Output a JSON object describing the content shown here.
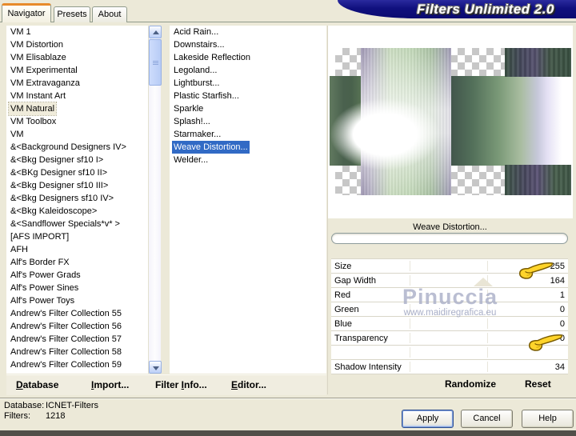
{
  "window": {
    "title": "Filters Unlimited 2.0",
    "tabs": [
      {
        "label": "Navigator",
        "active": true
      },
      {
        "label": "Presets",
        "active": false
      },
      {
        "label": "About",
        "active": false
      }
    ]
  },
  "category_list": {
    "items": [
      {
        "label": "VM 1"
      },
      {
        "label": "VM Distortion"
      },
      {
        "label": "VM Elisablaze"
      },
      {
        "label": "VM Experimental"
      },
      {
        "label": "VM Extravaganza"
      },
      {
        "label": "VM Instant Art"
      },
      {
        "label": "VM Natural",
        "selected": true
      },
      {
        "label": "VM Toolbox"
      },
      {
        "label": "VM"
      },
      {
        "label": "&<Background Designers IV>"
      },
      {
        "label": "&<Bkg Designer sf10 I>"
      },
      {
        "label": "&<BKg Designer sf10 II>"
      },
      {
        "label": "&<Bkg Designer sf10 III>"
      },
      {
        "label": "&<Bkg Designers sf10 IV>"
      },
      {
        "label": "&<Bkg Kaleidoscope>"
      },
      {
        "label": "&<Sandflower Specials*v* >"
      },
      {
        "label": "[AFS IMPORT]"
      },
      {
        "label": "AFH"
      },
      {
        "label": "Alf's Border FX"
      },
      {
        "label": "Alf's Power Grads"
      },
      {
        "label": "Alf's Power Sines"
      },
      {
        "label": "Alf's Power Toys"
      },
      {
        "label": "Andrew's Filter Collection 55"
      },
      {
        "label": "Andrew's Filter Collection 56"
      },
      {
        "label": "Andrew's Filter Collection 57"
      },
      {
        "label": "Andrew's Filter Collection 58"
      },
      {
        "label": "Andrew's Filter Collection 59"
      }
    ]
  },
  "filter_list": {
    "items": [
      {
        "label": "Acid Rain..."
      },
      {
        "label": "Downstairs..."
      },
      {
        "label": "Lakeside Reflection"
      },
      {
        "label": "Legoland..."
      },
      {
        "label": "Lightburst..."
      },
      {
        "label": "Plastic Starfish..."
      },
      {
        "label": "Sparkle"
      },
      {
        "label": "Splash!..."
      },
      {
        "label": "Starmaker..."
      },
      {
        "label": "Weave Distortion...",
        "selected": true
      },
      {
        "label": "Welder..."
      }
    ]
  },
  "preview": {
    "filter_name": "Weave Distortion...",
    "progress_percent": 0
  },
  "parameters": {
    "rows": [
      {
        "label": "Size",
        "value": "255"
      },
      {
        "label": "Gap Width",
        "value": "164"
      },
      {
        "label": "Red",
        "value": "1"
      },
      {
        "label": "Green",
        "value": "0"
      },
      {
        "label": "Blue",
        "value": "0"
      },
      {
        "label": "Transparency",
        "value": "0"
      },
      {
        "label": "",
        "value": ""
      },
      {
        "label": "Shadow Intensity",
        "value": "34"
      }
    ]
  },
  "watermark": {
    "name": "Pinuccia",
    "url": "www.maidiregrafica.eu"
  },
  "actions": {
    "randomize": "Randomize",
    "reset": "Reset"
  },
  "menu_buttons": [
    {
      "pre": "",
      "mn": "D",
      "post": "atabase"
    },
    {
      "pre": "",
      "mn": "I",
      "post": "mport..."
    },
    {
      "pre": "Filter ",
      "mn": "I",
      "post": "nfo..."
    },
    {
      "pre": "",
      "mn": "E",
      "post": "ditor..."
    }
  ],
  "statusbar": {
    "database_label": "Database:",
    "database_value": "ICNET-Filters",
    "filters_label": "Filters:",
    "filters_value": "1218"
  },
  "dialog_buttons": {
    "apply": "Apply",
    "cancel": "Cancel",
    "help": "Help"
  },
  "icons": {
    "scroll_up": "triangle-up",
    "scroll_down": "triangle-down",
    "pointing_hand": "hand-pointing-right"
  },
  "colors": {
    "window_background": "#ece9d8",
    "titlebar_navy": "#10107e",
    "selection_blue": "#316ac5",
    "active_tab_accent": "#e78a2a",
    "list_background": "#ffffff"
  }
}
